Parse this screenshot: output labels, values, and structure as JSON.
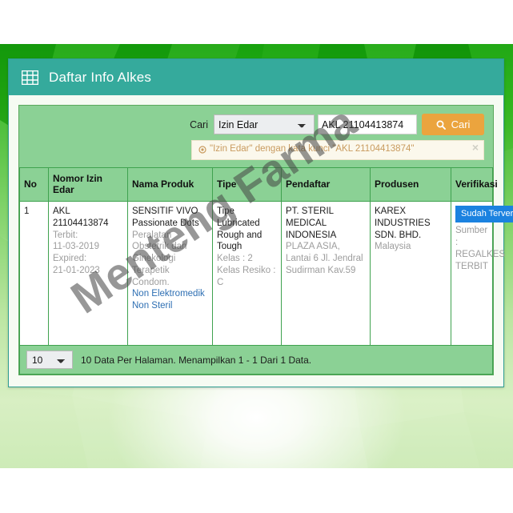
{
  "panel": {
    "icon": "table-grid-icon",
    "title": "Daftar Info Alkes"
  },
  "search": {
    "label": "Cari",
    "field_selected": "Izin Edar",
    "field_options": [
      "Izin Edar"
    ],
    "keyword_value": "AKL 21104413874",
    "keyword_placeholder": "",
    "button_label": "Cari",
    "button_icon": "search-icon",
    "button_color": "#eba43e"
  },
  "alert": {
    "icon": "ban-circle-icon",
    "text": "\"Izin Edar\" dengan kata kunci \"AKL 21104413874\"",
    "close_label": "×"
  },
  "table": {
    "headers": [
      "No",
      "Nomor Izin Edar",
      "Nama Produk",
      "Tipe",
      "Pendaftar",
      "Produsen",
      "Verifikasi"
    ],
    "rows": [
      {
        "no": "1",
        "izin": {
          "code": "AKL 21104413874",
          "terbit_label": "Terbit:",
          "terbit_value": "11-03-2019",
          "expired_label": "Expired:",
          "expired_value": "21-01-2023"
        },
        "nama": {
          "title": "SENSITIF VIVO Passionate Dots",
          "category": "Peralatan Obstetrik dan Ginekologi Terapetik Condom.",
          "tag1": "Non Elektromedik",
          "tag2": "Non Steril"
        },
        "tipe": {
          "title": "Tipe Lubricated Rough and Tough",
          "kelas": "Kelas : 2",
          "resiko": "Kelas Resiko : C"
        },
        "pendaftar": {
          "name": "PT. STERIL MEDICAL INDONESIA",
          "address": "PLAZA ASIA, Lantai 6 Jl. Jendral Sudirman Kav.59"
        },
        "produsen": {
          "name": "KAREX INDUSTRIES SDN. BHD.",
          "country": "Malaysia"
        },
        "verifikasi": {
          "badge": "Sudah Terverifikasi",
          "badge_color": "#1b82e0",
          "source": "Sumber : REGALKES TERBIT"
        }
      }
    ]
  },
  "footer": {
    "per_page_selected": "10",
    "per_page_options": [
      "10"
    ],
    "info": "10 Data Per Halaman. Menampilkan 1 - 1 Dari 1 Data."
  },
  "watermark": {
    "text": "Menteng Farma"
  }
}
